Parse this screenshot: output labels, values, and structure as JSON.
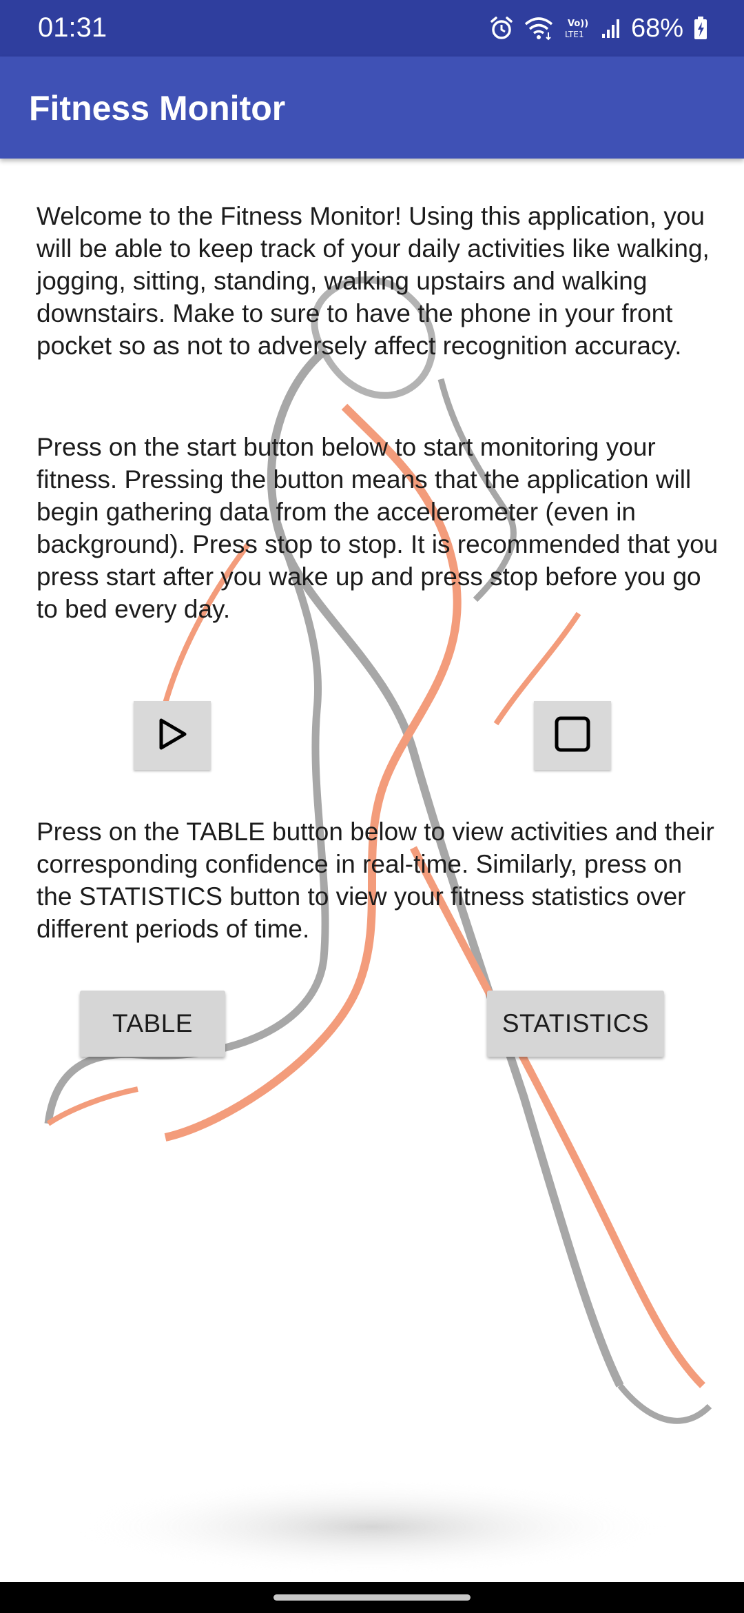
{
  "status_bar": {
    "time": "01:31",
    "battery": "68%",
    "icons": [
      "alarm-icon",
      "wifi-icon",
      "volte-icon",
      "signal-icon",
      "battery-charging-icon"
    ]
  },
  "app_bar": {
    "title": "Fitness Monitor",
    "color": "#3f51b5"
  },
  "content": {
    "paragraph_1": "Welcome to the Fitness Monitor! Using this application, you will be able to keep track of your daily activities like walking, jogging, sitting, standing, walking upstairs and walking downstairs. Make to sure to have the phone in your front pocket so as not to adversely affect recognition accuracy.",
    "paragraph_2": "Press on the start button below to start monitoring your fitness. Pressing the button means that the application will begin gathering data from the accelerometer (even in background). Press stop to stop. It is recommended that you press start after you wake up and press stop before you go to bed every day.",
    "paragraph_3": "Press on the TABLE button below to view activities and their corresponding confidence in real-time. Similarly, press on the STATISTICS button to view your fitness statistics over different periods of time.",
    "start_icon": "play-icon",
    "stop_icon": "stop-icon",
    "table_button": "TABLE",
    "statistics_button": "STATISTICS"
  }
}
